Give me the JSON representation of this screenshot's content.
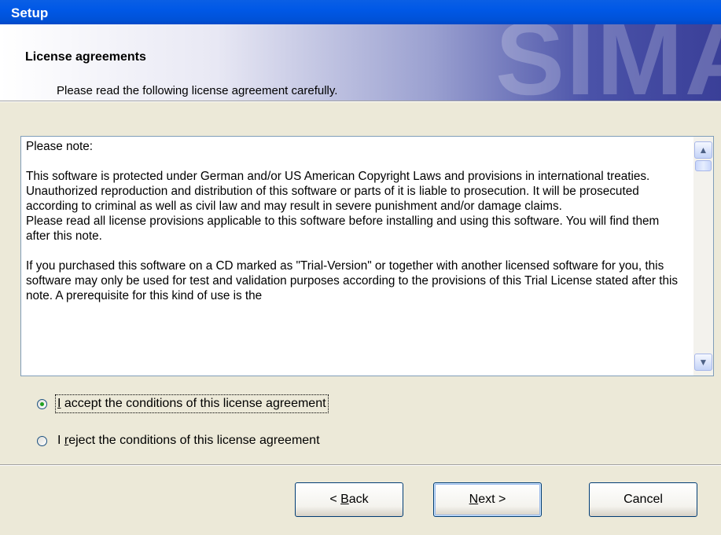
{
  "window": {
    "title": "Setup"
  },
  "header": {
    "title": "License agreements",
    "subtitle": "Please read the following license agreement carefully.",
    "watermark": "SIMA"
  },
  "license": {
    "paragraphs": [
      "Please note:",
      "",
      "This software is protected under German and/or US American Copyright Laws and provisions in international treaties. Unauthorized reproduction and distribution of this software or parts of it is liable to prosecution. It will be prosecuted according to criminal as well as civil law and may result in severe punishment and/or damage claims.",
      "Please read all license provisions applicable to this software before installing and using this software. You will find them after this note.",
      "",
      "If you purchased this software on a CD marked as \"Trial-Version\" or together with another licensed software for you, this software may only be used for test and validation purposes according to the provisions of this Trial License stated after this note. A prerequisite for this kind of use is the"
    ]
  },
  "options": {
    "accept": {
      "pre": "",
      "accel": "I",
      "post": " accept the conditions of this license agreement",
      "selected": true
    },
    "reject": {
      "pre": "I ",
      "accel": "r",
      "post": "eject the conditions of this license agreement",
      "selected": false
    }
  },
  "buttons": {
    "back": {
      "pre": "< ",
      "accel": "B",
      "post": "ack"
    },
    "next": {
      "pre": "",
      "accel": "N",
      "post": "ext >"
    },
    "cancel": {
      "label": "Cancel"
    }
  },
  "colors": {
    "titlebar": "#0058e6",
    "dialog_bg": "#ece9d8",
    "radio_dot": "#21a121"
  },
  "icons": {
    "scroll_up": "▲",
    "scroll_down": "▼"
  }
}
